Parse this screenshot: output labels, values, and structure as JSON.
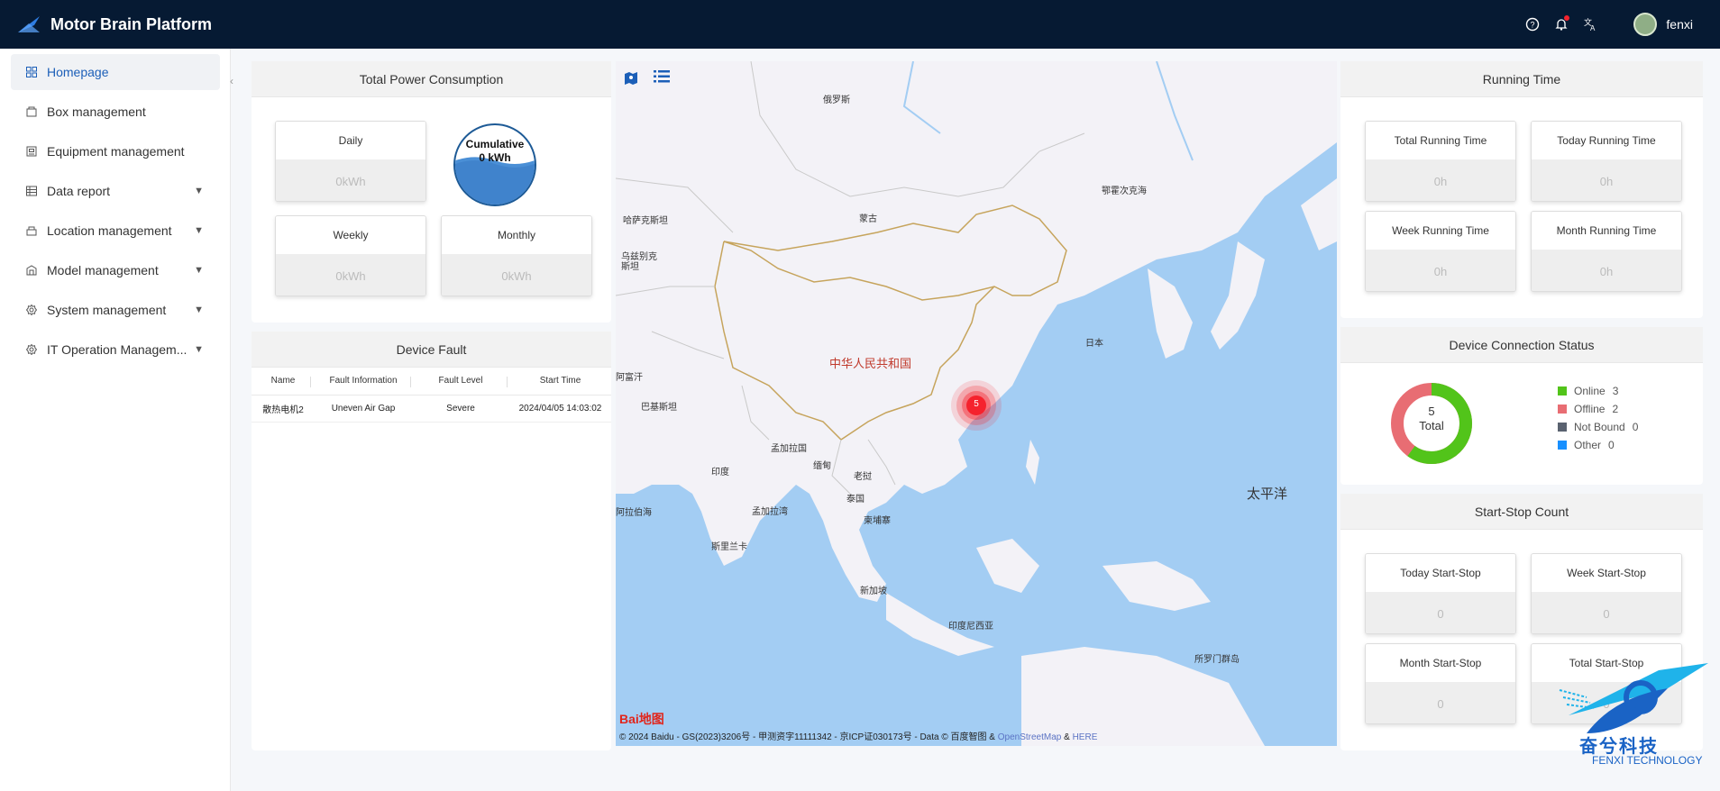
{
  "app": {
    "title": "Motor Brain Platform",
    "username": "fenxi"
  },
  "header_icons": [
    "help-icon",
    "bell-icon",
    "translate-icon"
  ],
  "sidebar": {
    "items": [
      {
        "label": "Homepage",
        "icon": "home-icon",
        "active": true
      },
      {
        "label": "Box management",
        "icon": "box-icon"
      },
      {
        "label": "Equipment management",
        "icon": "equipment-icon"
      },
      {
        "label": "Data report",
        "icon": "table-icon",
        "expandable": true
      },
      {
        "label": "Location management",
        "icon": "location-icon",
        "expandable": true
      },
      {
        "label": "Model management",
        "icon": "model-icon",
        "expandable": true
      },
      {
        "label": "System management",
        "icon": "gear-icon",
        "expandable": true
      },
      {
        "label": "IT Operation Managem...",
        "icon": "gear-icon",
        "expandable": true
      }
    ]
  },
  "power": {
    "title": "Total Power Consumption",
    "daily_label": "Daily",
    "daily_value": "0kWh",
    "weekly_label": "Weekly",
    "weekly_value": "0kWh",
    "monthly_label": "Monthly",
    "monthly_value": "0kWh",
    "cumulative_label": "Cumulative",
    "cumulative_value": "0 kWh"
  },
  "fault": {
    "title": "Device Fault",
    "columns": [
      "Name",
      "Fault Information",
      "Fault Level",
      "Start Time"
    ],
    "rows": [
      [
        "散热电机2",
        "Uneven Air Gap",
        "Severe",
        "2024/04/05 14:03:02"
      ]
    ]
  },
  "map": {
    "labels": {
      "russia": "俄罗斯",
      "kazakhstan": "哈萨克斯坦",
      "mongolia": "蒙古",
      "uzbekistan": "乌兹别克斯坦",
      "china": "中华人民共和国",
      "afghanistan": "阿富汗",
      "pakistan": "巴基斯坦",
      "india": "印度",
      "bangladesh": "孟加拉国",
      "myanmar": "缅甸",
      "laos": "老挝",
      "thailand": "泰国",
      "cambodia": "柬埔寨",
      "arabian_sea": "阿拉伯海",
      "bay_of_bengal": "孟加拉湾",
      "sri_lanka": "斯里兰卡",
      "singapore": "新加坡",
      "indonesia": "印度尼西亚",
      "japan": "日本",
      "okhotsk": "鄂霍次克海",
      "pacific": "太平洋",
      "png": "所罗门群岛"
    },
    "cluster_count": "5",
    "baidu_logo": "Bai地图",
    "copyright": "© 2024 Baidu - GS(2023)3206号 - 甲测资字11111342 - 京ICP证030173号 - Data © 百度智图 &",
    "osm": "OpenStreetMap",
    "amp": "&",
    "here": "HERE"
  },
  "running": {
    "title": "Running Time",
    "total_label": "Total Running Time",
    "total_value": "0h",
    "today_label": "Today Running Time",
    "today_value": "0h",
    "week_label": "Week Running Time",
    "week_value": "0h",
    "month_label": "Month Running Time",
    "month_value": "0h"
  },
  "connection": {
    "title": "Device Connection Status",
    "total_num": "5",
    "total_label": "Total",
    "legend": [
      {
        "label": "Online",
        "value": "3",
        "color": "#52c41a"
      },
      {
        "label": "Offline",
        "value": "2",
        "color": "#e86d73"
      },
      {
        "label": "Not Bound",
        "value": "0",
        "color": "#5a6270"
      },
      {
        "label": "Other",
        "value": "0",
        "color": "#1890ff"
      }
    ]
  },
  "startstop": {
    "title": "Start-Stop Count",
    "today_label": "Today Start-Stop",
    "today_value": "0",
    "week_label": "Week Start-Stop",
    "week_value": "0",
    "month_label": "Month Start-Stop",
    "month_value": "0",
    "total_label": "Total Start-Stop",
    "total_value": "0"
  },
  "brand": {
    "cn": "奋兮科技",
    "en": "FENXI TECHNOLOGY"
  }
}
